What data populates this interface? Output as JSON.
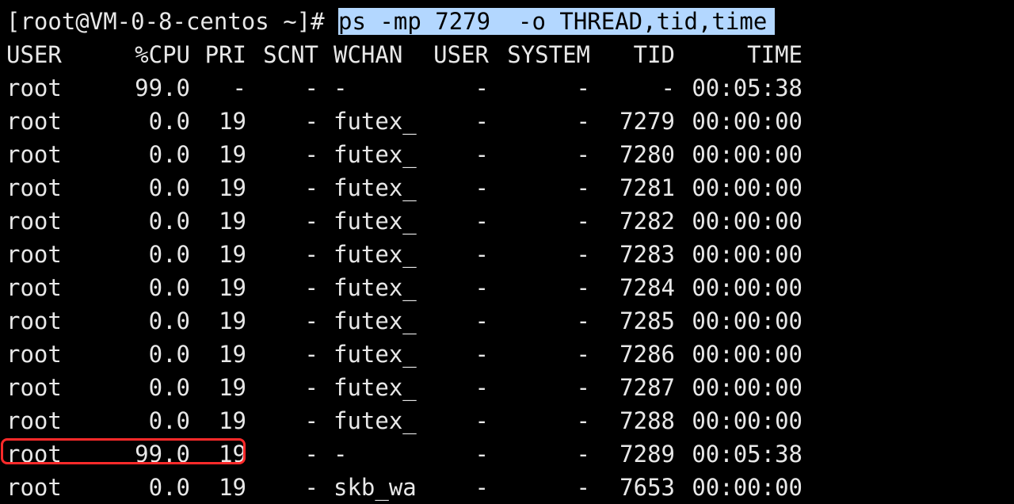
{
  "terminal": {
    "prompt": "[root@VM-0-8-centos ~]# ",
    "command": "ps -mp 7279  -o THREAD,tid,time",
    "selection_color": "#b3d7ff",
    "highlight_color": "#ff2a2a"
  },
  "table": {
    "headers": {
      "user": "USER",
      "cpu": "%CPU",
      "pri": "PRI",
      "scnt": "SCNT",
      "wchan": "WCHAN",
      "usr": "USER",
      "sys": "SYSTEM",
      "tid": "TID",
      "time": "TIME"
    },
    "rows": [
      {
        "user": "root",
        "cpu": "99.0",
        "pri": "-",
        "scnt": "-",
        "wchan": "-",
        "usr": "-",
        "sys": "-",
        "tid": "-",
        "time": "00:05:38"
      },
      {
        "user": "root",
        "cpu": "0.0",
        "pri": "19",
        "scnt": "-",
        "wchan": "futex_",
        "usr": "-",
        "sys": "-",
        "tid": "7279",
        "time": "00:00:00"
      },
      {
        "user": "root",
        "cpu": "0.0",
        "pri": "19",
        "scnt": "-",
        "wchan": "futex_",
        "usr": "-",
        "sys": "-",
        "tid": "7280",
        "time": "00:00:00"
      },
      {
        "user": "root",
        "cpu": "0.0",
        "pri": "19",
        "scnt": "-",
        "wchan": "futex_",
        "usr": "-",
        "sys": "-",
        "tid": "7281",
        "time": "00:00:00"
      },
      {
        "user": "root",
        "cpu": "0.0",
        "pri": "19",
        "scnt": "-",
        "wchan": "futex_",
        "usr": "-",
        "sys": "-",
        "tid": "7282",
        "time": "00:00:00"
      },
      {
        "user": "root",
        "cpu": "0.0",
        "pri": "19",
        "scnt": "-",
        "wchan": "futex_",
        "usr": "-",
        "sys": "-",
        "tid": "7283",
        "time": "00:00:00"
      },
      {
        "user": "root",
        "cpu": "0.0",
        "pri": "19",
        "scnt": "-",
        "wchan": "futex_",
        "usr": "-",
        "sys": "-",
        "tid": "7284",
        "time": "00:00:00"
      },
      {
        "user": "root",
        "cpu": "0.0",
        "pri": "19",
        "scnt": "-",
        "wchan": "futex_",
        "usr": "-",
        "sys": "-",
        "tid": "7285",
        "time": "00:00:00"
      },
      {
        "user": "root",
        "cpu": "0.0",
        "pri": "19",
        "scnt": "-",
        "wchan": "futex_",
        "usr": "-",
        "sys": "-",
        "tid": "7286",
        "time": "00:00:00"
      },
      {
        "user": "root",
        "cpu": "0.0",
        "pri": "19",
        "scnt": "-",
        "wchan": "futex_",
        "usr": "-",
        "sys": "-",
        "tid": "7287",
        "time": "00:00:00"
      },
      {
        "user": "root",
        "cpu": "0.0",
        "pri": "19",
        "scnt": "-",
        "wchan": "futex_",
        "usr": "-",
        "sys": "-",
        "tid": "7288",
        "time": "00:00:00"
      },
      {
        "user": "root",
        "cpu": "99.0",
        "pri": "19",
        "scnt": "-",
        "wchan": "-",
        "usr": "-",
        "sys": "-",
        "tid": "7289",
        "time": "00:05:38"
      },
      {
        "user": "root",
        "cpu": "0.0",
        "pri": "19",
        "scnt": "-",
        "wchan": "skb_wa",
        "usr": "-",
        "sys": "-",
        "tid": "7653",
        "time": "00:00:00"
      }
    ]
  }
}
